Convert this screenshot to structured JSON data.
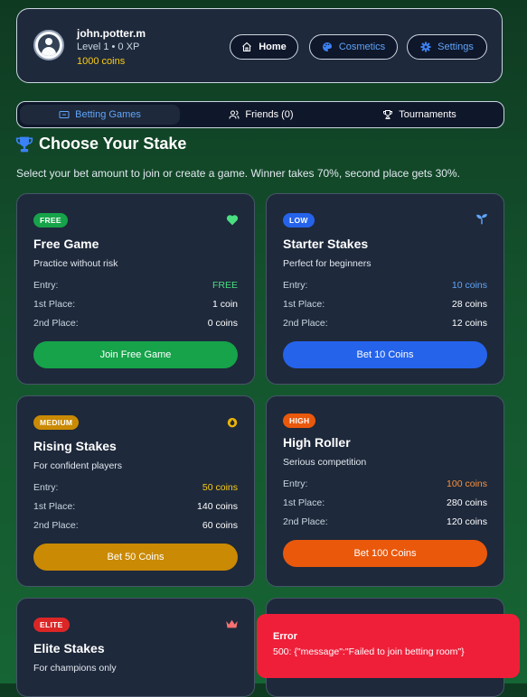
{
  "user": {
    "username": "john.potter.m",
    "level_text": "Level 1 • 0 XP",
    "coins_text": "1000 coins"
  },
  "nav": {
    "home": "Home",
    "cosmetics": "Cosmetics",
    "settings": "Settings"
  },
  "tabs": {
    "betting": "Betting Games",
    "friends": "Friends (0)",
    "tournaments": "Tournaments"
  },
  "heading": {
    "title": "Choose Your Stake",
    "subtitle": "Select your bet amount to join or create a game. Winner takes 70%, second place gets 30%."
  },
  "labels": {
    "entry": "Entry:",
    "first": "1st Place:",
    "second": "2nd Place:"
  },
  "cards": [
    {
      "badge": "FREE",
      "badge_color": "#16a34a",
      "name": "Free Game",
      "desc": "Practice without risk",
      "entry": "FREE",
      "entry_color": "#4ade80",
      "first": "1 coin",
      "second": "0 coins",
      "button": "Join Free Game",
      "button_color": "#16a34a",
      "icon": "heart-icon"
    },
    {
      "badge": "LOW",
      "badge_color": "#2563eb",
      "name": "Starter Stakes",
      "desc": "Perfect for beginners",
      "entry": "10 coins",
      "entry_color": "#60a5fa",
      "first": "28 coins",
      "second": "12 coins",
      "button": "Bet 10 Coins",
      "button_color": "#2563eb",
      "icon": "sprout-icon"
    },
    {
      "badge": "MEDIUM",
      "badge_color": "#ca8a04",
      "name": "Rising Stakes",
      "desc": "For confident players",
      "entry": "50 coins",
      "entry_color": "#facc15",
      "first": "140 coins",
      "second": "60 coins",
      "button": "Bet 50 Coins",
      "button_color": "#ca8a04",
      "icon": "flame-icon"
    },
    {
      "badge": "HIGH",
      "badge_color": "#ea580c",
      "name": "High Roller",
      "desc": "Serious competition",
      "entry": "100 coins",
      "entry_color": "#fb923c",
      "first": "280 coins",
      "second": "120 coins",
      "button": "Bet 100 Coins",
      "button_color": "#ea580c",
      "icon": ""
    },
    {
      "badge": "ELITE",
      "badge_color": "#dc2626",
      "name": "Elite Stakes",
      "desc": "For champions only",
      "icon": "crown-icon"
    }
  ],
  "toast": {
    "title": "Error",
    "message": "500: {\"message\":\"Failed to join betting room\"}"
  },
  "colors": {
    "toast_bg": "#ef1f3a",
    "card_bg": "#1e293b",
    "accent_blue": "#60a5fa",
    "coins_yellow": "#facc15"
  }
}
